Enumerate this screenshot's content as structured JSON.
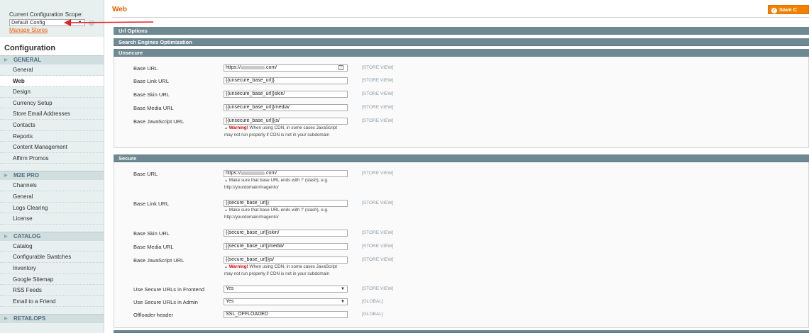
{
  "scope": {
    "label": "Current Configuration Scope:",
    "selected": "Default Config",
    "manage_stores": "Manage Stores"
  },
  "sidebar": {
    "title": "Configuration",
    "groups": [
      {
        "label": "GENERAL",
        "items": [
          "General",
          "Web",
          "Design",
          "Currency Setup",
          "Store Email Addresses",
          "Contacts",
          "Reports",
          "Content Management",
          "Affirm Promos"
        ]
      },
      {
        "label": "M2E PRO",
        "items": [
          "Channels",
          "General",
          "Logs Clearing",
          "License"
        ]
      },
      {
        "label": "CATALOG",
        "items": [
          "Catalog",
          "Configurable Swatches",
          "Inventory",
          "Google Sitemap",
          "RSS Feeds",
          "Email to a Friend"
        ]
      },
      {
        "label": "RETAILOPS",
        "items": []
      }
    ],
    "active_item": "Web"
  },
  "header": {
    "title": "Web",
    "save_label": "Save C"
  },
  "sections": {
    "url_options": "Url Options",
    "seo": "Search Engines Optimization",
    "unsecure": {
      "title": "Unsecure",
      "rows": [
        {
          "label": "Base URL",
          "value_prefix": "https://",
          "value_suffix": ".com/",
          "scope": "[STORE VIEW]"
        },
        {
          "label": "Base Link URL",
          "value": "{{unsecure_base_url}}",
          "scope": "[STORE VIEW]"
        },
        {
          "label": "Base Skin URL",
          "value": "{{unsecure_base_url}}skin/",
          "scope": "[STORE VIEW]"
        },
        {
          "label": "Base Media URL",
          "value": "{{unsecure_base_url}}media/",
          "scope": "[STORE VIEW]"
        },
        {
          "label": "Base JavaScript URL",
          "value": "{{unsecure_base_url}}js/",
          "scope": "[STORE VIEW]"
        }
      ],
      "js_note_warning": "Warning!",
      "js_note_line1": " When using CDN, in some cases JavaScript",
      "js_note_line2": "may not run properly if CDN is not in your subdomain"
    },
    "secure": {
      "title": "Secure",
      "rows": [
        {
          "label": "Base URL",
          "value_prefix": "https://",
          "value_suffix": ".com/",
          "scope": "[STORE VIEW]"
        },
        {
          "label": "Base Link URL",
          "value": "{{secure_base_url}}",
          "scope": "[STORE VIEW]"
        },
        {
          "label": "Base Skin URL",
          "value": "{{secure_base_url}}skin/",
          "scope": "[STORE VIEW]"
        },
        {
          "label": "Base Media URL",
          "value": "{{secure_base_url}}media/",
          "scope": "[STORE VIEW]"
        },
        {
          "label": "Base JavaScript URL",
          "value": "{{secure_base_url}}js/",
          "scope": "[STORE VIEW]"
        },
        {
          "label": "Use Secure URLs in Frontend",
          "value": "Yes",
          "scope": "[STORE VIEW]"
        },
        {
          "label": "Use Secure URLs in Admin",
          "value": "Yes",
          "scope": "[GLOBAL]"
        },
        {
          "label": "Offloader header",
          "value": "SSL_OFFLOADED",
          "scope": "[GLOBAL]"
        }
      ],
      "slash_note_line1": " Make sure that base URL ends with '/' (slash), e.g.",
      "slash_note_line2": "http://yourdomain/magento/",
      "js_note_warning": "Warning!",
      "js_note_line1": " When using CDN, in some cases JavaScript",
      "js_note_line2": "may not run properly if CDN is not in your subdomain"
    }
  },
  "colors": {
    "accent": "#eb5e00",
    "section_header": "#6f8992",
    "sidebar_bg": "#e7efef",
    "warning": "#d40707"
  }
}
